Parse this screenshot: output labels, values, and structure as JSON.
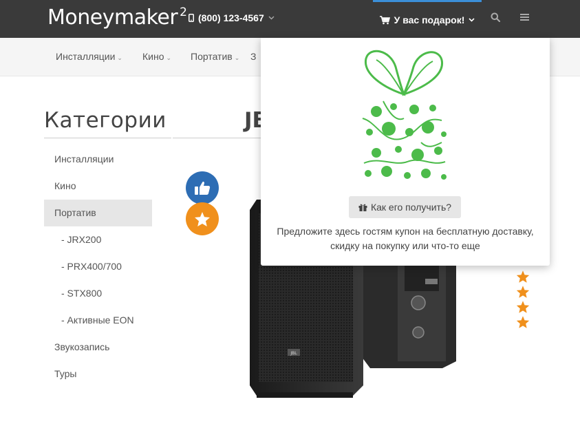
{
  "header": {
    "logo_main": "Money",
    "logo_light": "maker",
    "logo_sup": "2",
    "phone": "(800) 123-4567",
    "gift_label": "У вас подарок!"
  },
  "nav": {
    "items": [
      "Инсталляции",
      "Кино",
      "Портатив",
      "З"
    ]
  },
  "sidebar": {
    "title": "Категории",
    "items": [
      {
        "label": "Инсталляции"
      },
      {
        "label": "Кино"
      },
      {
        "label": "Портатив"
      },
      {
        "label": "- JRX200"
      },
      {
        "label": "- PRX400/700"
      },
      {
        "label": "- STX800"
      },
      {
        "label": "- Активные EON"
      },
      {
        "label": "Звукозапись"
      },
      {
        "label": "Туры"
      }
    ],
    "active_index": 2
  },
  "main": {
    "title_fragment": "JB"
  },
  "popup": {
    "button_label": "Как его получить?",
    "text_line1": "Предложите здесь гостям купон на бесплатную доставку,",
    "text_line2": "скидку на покупку или что-то еще"
  },
  "rating": {
    "visible_stars": 4
  },
  "colors": {
    "topbar": "#3a3a3a",
    "accent_blue": "#2d6db4",
    "accent_orange": "#f0901c",
    "gift_green": "#4cbb4a",
    "tab_highlight": "#3b8fd8"
  },
  "icons": {
    "phone": "mobile-phone-icon",
    "gift_tab": "shopping-cart-icon",
    "search": "search-icon",
    "menu": "hamburger-menu-icon",
    "like": "thumbs-up-icon",
    "favorite": "star-icon",
    "howto": "gift-icon"
  }
}
